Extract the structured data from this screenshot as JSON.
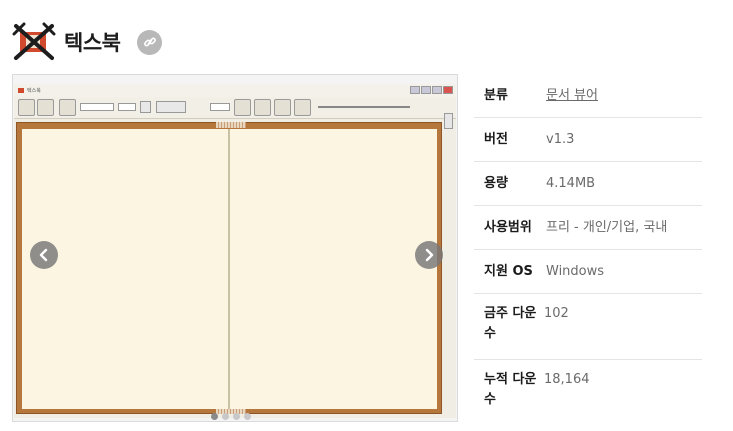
{
  "header": {
    "logo_icon": "texbook-logo-icon",
    "title": "텍스북",
    "link_icon": "link-icon"
  },
  "gallery": {
    "screenshot": {
      "window_title": "텍스북",
      "window_controls": [
        "minimize-icon",
        "maximize-icon",
        "close-icon"
      ],
      "toolbar_icons": [
        "open-book-icon",
        "bookshelf-icon",
        "bookmark-icon"
      ],
      "accent_colors": {
        "book_cover": "#b5773c",
        "page": "#fcf5e2"
      }
    },
    "prev_icon": "chevron-left-icon",
    "next_icon": "chevron-right-icon",
    "slide_count": 4,
    "active_slide": 1
  },
  "info": [
    {
      "label": "분류",
      "value": "문서 뷰어",
      "is_link": true
    },
    {
      "label": "버전",
      "value": "v1.3"
    },
    {
      "label": "용량",
      "value": "4.14MB"
    },
    {
      "label": "사용범위",
      "value": "프리 - 개인/기업, 국내"
    },
    {
      "label": "지원 OS",
      "value": "Windows"
    },
    {
      "label": "금주 다운수",
      "value": "102"
    },
    {
      "label": "누적 다운수",
      "value": "18,164"
    }
  ]
}
